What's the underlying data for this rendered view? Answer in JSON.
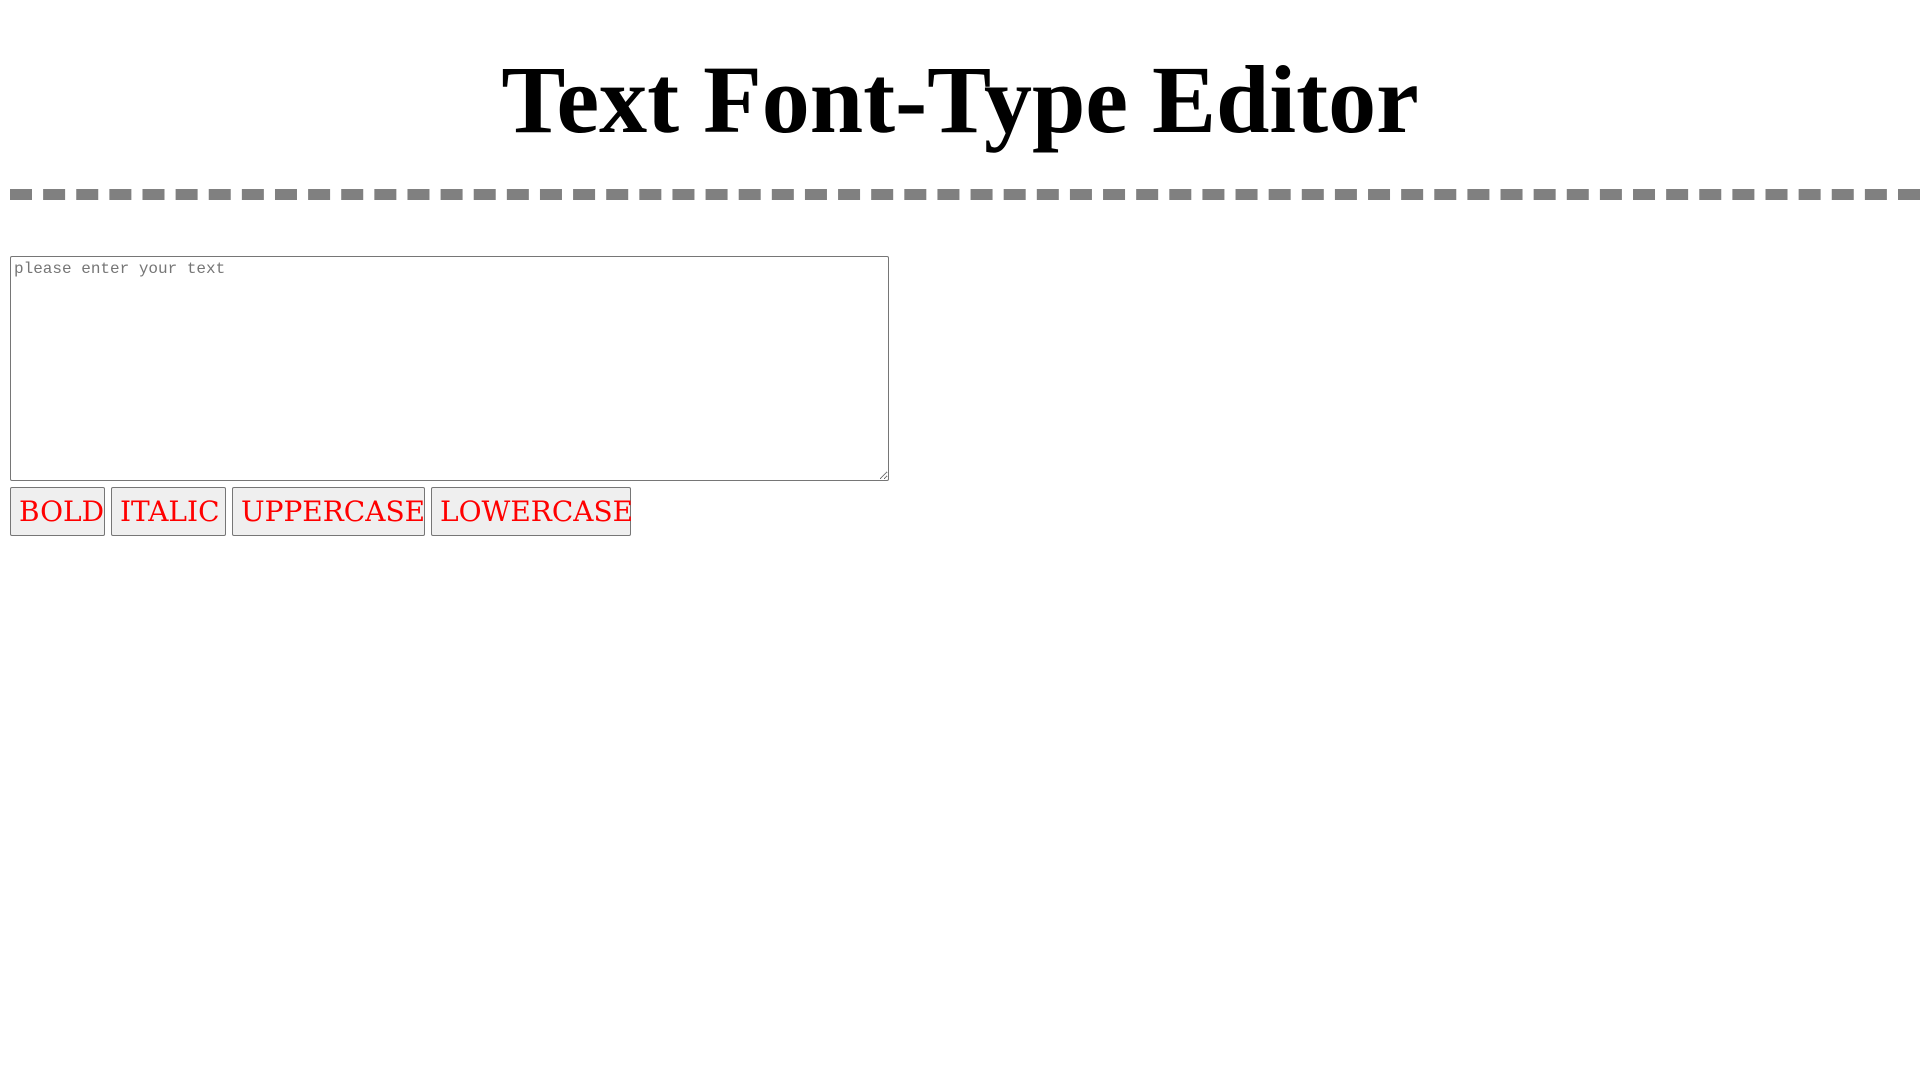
{
  "header": {
    "title": "Text Font-Type Editor"
  },
  "editor": {
    "value": "",
    "placeholder": "please enter your text"
  },
  "toolbar": {
    "buttons": [
      {
        "label": "BOLD"
      },
      {
        "label": "ITALIC"
      },
      {
        "label": "UPPERCASE"
      },
      {
        "label": "LOWERCASE"
      }
    ]
  },
  "colors": {
    "button_text": "#ff0000",
    "button_background": "#efefef",
    "divider": "#808080",
    "title": "#000000"
  }
}
